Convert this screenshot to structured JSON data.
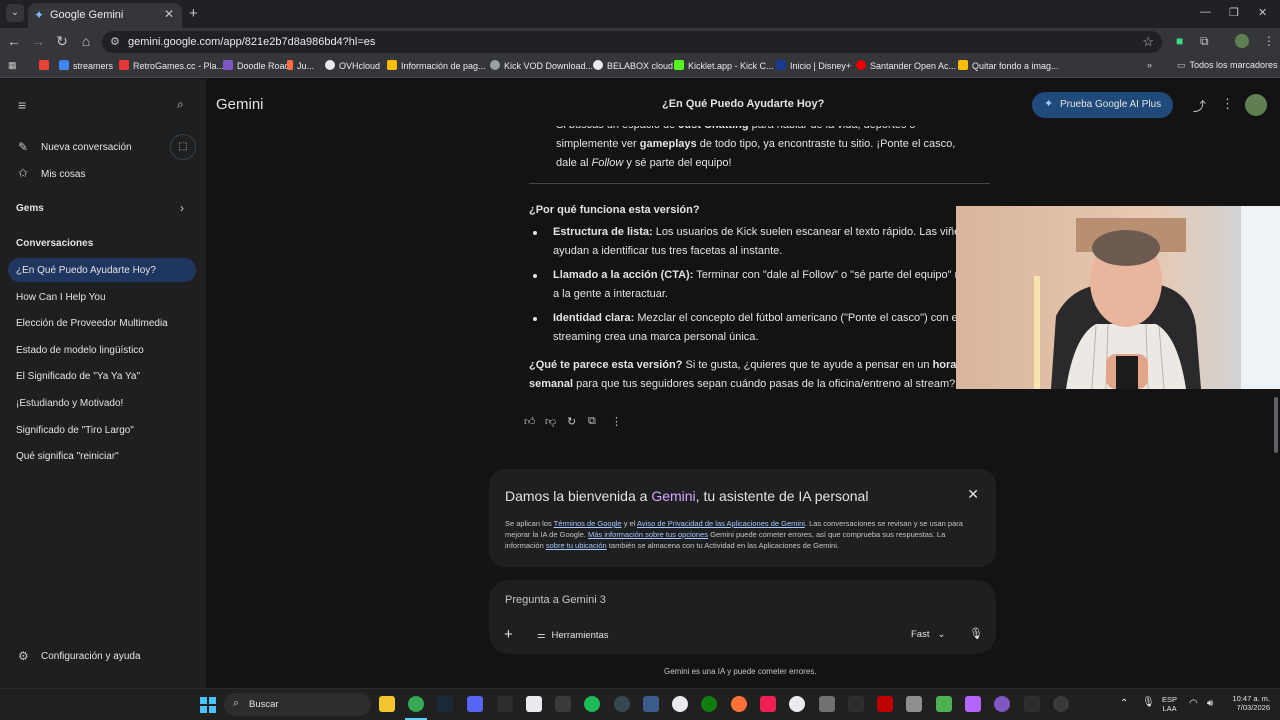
{
  "browser": {
    "tab_title": "Google Gemini",
    "url": "gemini.google.com/app/821e2b7d8a986bd4?hl=es",
    "bookmarks": [
      "streamers",
      "RetroGames.cc - Pla...",
      "Doodle Road",
      "Ju...",
      "OVHcloud",
      "Información de pag...",
      "Kick VOD Download...",
      "BELABOX cloud",
      "Kicklet.app - Kick C...",
      "Inicio | Disney+",
      "Santander Open Ac...",
      "Quitar fondo a imag..."
    ],
    "all_bookmarks": "Todos los marcadores"
  },
  "sidebar": {
    "new_chat": "Nueva conversación",
    "my_stuff": "Mis cosas",
    "gems": "Gems",
    "conversations_heading": "Conversaciones",
    "conversations": [
      "¿En Qué Puedo Ayudarte Hoy?",
      "How Can I Help You",
      "Elección de Proveedor Multimedia",
      "Estado de modelo lingüístico",
      "El Significado de \"Ya Ya Ya\"",
      "¡Estudiando y Motivado!",
      "Significado de \"Tiro Largo\"",
      "Qué significa \"reiniciar\""
    ],
    "settings": "Configuración y ayuda"
  },
  "header": {
    "app_name": "Gemini",
    "chat_title": "¿En Qué Puedo Ayudarte Hoy?",
    "upgrade_button": "Prueba Google AI Plus"
  },
  "response": {
    "top_line1_pre": "Si buscas un espacio de ",
    "top_line1_bold": "Just Chatting",
    "top_line1_post": " para hablar de la vida, deportes o",
    "top_line2_pre": "simplemente ver ",
    "top_line2_bold": "gameplays",
    "top_line2_post": " de todo tipo, ya encontraste tu sitio. ¡Ponte el casco,",
    "top_line3_pre": "dale al ",
    "top_line3_italic": "Follow",
    "top_line3_post": " y sé parte del equipo!",
    "why_heading": "¿Por qué funciona esta versión?",
    "bullets": [
      {
        "bold": "Estructura de lista:",
        "line1": " Los usuarios de Kick suelen escanear el texto rápido. Las viñetas",
        "line2": "ayudan a identificar tus tres facetas al instante."
      },
      {
        "bold": "Llamado a la acción (CTA):",
        "line1": " Terminar con \"dale al Follow\" o \"sé parte del equipo\" motiva",
        "line2": "a la gente a interactuar."
      },
      {
        "bold": "Identidad clara:",
        "line1": " Mezclar el concepto del fútbol americano (\"Ponte el casco\") con el",
        "line2": "streaming crea una marca personal única."
      }
    ],
    "question_bold": "¿Qué te parece esta versión?",
    "question_line1": " Si te gusta, ¿quieres que te ayude a pensar en un ",
    "question_bold2": "horario",
    "question_bold3": "semanal",
    "question_line2": " para que tus seguidores sepan cuándo pasas de la oficina/entreno al stream?"
  },
  "welcome": {
    "title_pre": "Damos la bienvenida a ",
    "title_brand": "Gemini",
    "title_post": ", tu asistente de IA personal",
    "p1": "Se aplican los ",
    "link1": "Términos de Google",
    "p2": " y el ",
    "link2": "Aviso de Privacidad de las Aplicaciones de Gemini",
    "p3": ". Las conversaciones se revisan y se usan para mejorar la IA de Google. ",
    "link3": "Más información sobre tus opciones",
    "p4": " Gemini puede cometer errores, así que comprueba sus respuestas. La información ",
    "link4": "sobre tu ubicación",
    "p5": " también se almacena con tu Actividad en las Aplicaciones de Gemini."
  },
  "input": {
    "placeholder": "Pregunta a Gemini 3",
    "tools": "Herramientas",
    "mode": "Fast"
  },
  "disclaimer": "Gemini es una IA y puede cometer errores.",
  "taskbar": {
    "search": "Buscar",
    "lang_top": "ESP",
    "lang_bottom": "LAA",
    "time": "10:47 a. m.",
    "date": "7/03/2026"
  }
}
